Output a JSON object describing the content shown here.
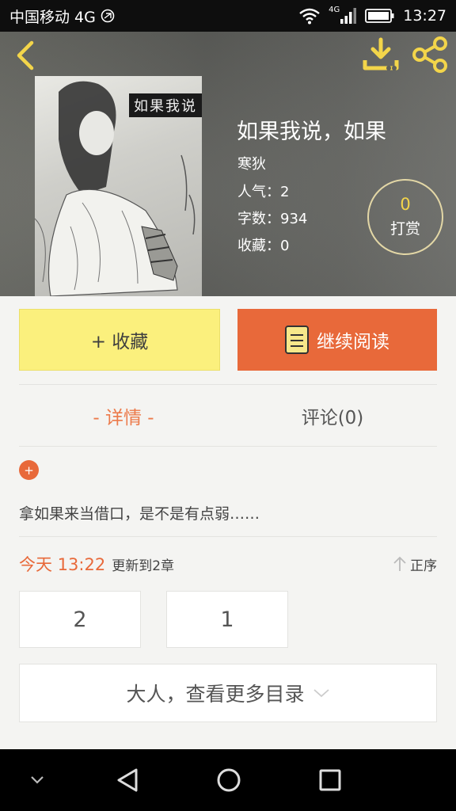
{
  "status_bar": {
    "carrier": "中国移动 4G",
    "network_badge": "4G",
    "time": "13:27"
  },
  "book": {
    "cover_title": "如果我说",
    "title": "如果我说，如果",
    "author": "寒狄",
    "popularity": "人气：2",
    "word_count": "字数：934",
    "favorites": "收藏：0"
  },
  "tip": {
    "count": "0",
    "label": "打赏"
  },
  "actions": {
    "collect_label": "+ 收藏",
    "read_label": "继续阅读"
  },
  "tabs": {
    "detail": "- 详情 -",
    "comment": "评论(0)"
  },
  "detail": {
    "expand_icon": "+",
    "description": "拿如果来当借口，是不是有点弱……"
  },
  "update": {
    "time": "今天 13:22",
    "text": "更新到2章",
    "sort_label": "正序"
  },
  "chapters": [
    "2",
    "1"
  ],
  "more_toc_label": "大人，查看更多目录",
  "icons": {
    "back": "chevron-left-icon",
    "download": "download-icon",
    "share": "share-icon",
    "book": "book-icon",
    "sort": "arrow-up-icon",
    "more": "chevron-down-icon"
  },
  "colors": {
    "accent_orange": "#e8693a",
    "collect_yellow": "#fbf07d",
    "header_icon_yellow": "#f3d54a"
  }
}
